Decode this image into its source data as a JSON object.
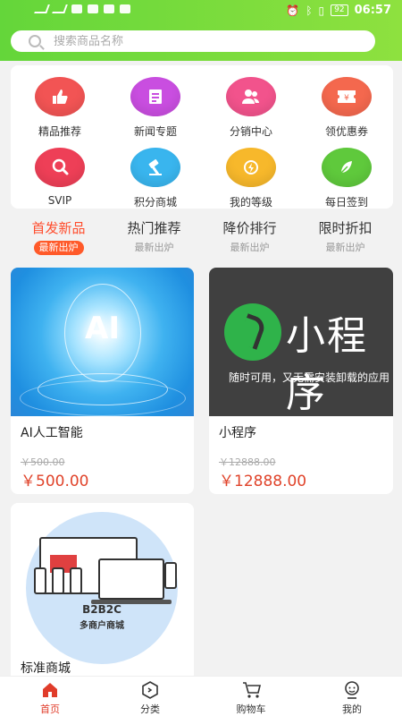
{
  "status_bar": {
    "time": "06:57",
    "battery": "92"
  },
  "search": {
    "placeholder": "搜索商品名称"
  },
  "menu": [
    {
      "label": "精品推荐",
      "icon": "thumbs-up-icon",
      "color": "#f25454"
    },
    {
      "label": "新闻专题",
      "icon": "news-icon",
      "color": "#c94ee0"
    },
    {
      "label": "分销中心",
      "icon": "users-icon",
      "color": "#f2538c"
    },
    {
      "label": "领优惠券",
      "icon": "coupon-icon",
      "color": "#f4684e"
    },
    {
      "label": "SVIP",
      "icon": "vip-icon",
      "color": "#ee3f57"
    },
    {
      "label": "积分商城",
      "icon": "hammer-icon",
      "color": "#39b5ee"
    },
    {
      "label": "我的等级",
      "icon": "level-icon",
      "color": "#f7b82b"
    },
    {
      "label": "每日签到",
      "icon": "sign-in-icon",
      "color": "#5fc93c"
    }
  ],
  "tabs": [
    {
      "title": "首发新品",
      "sub": "最新出炉"
    },
    {
      "title": "热门推荐",
      "sub": "最新出炉"
    },
    {
      "title": "降价排行",
      "sub": "最新出炉"
    },
    {
      "title": "限时折扣",
      "sub": "最新出炉"
    }
  ],
  "products": [
    {
      "name": "AI人工智能",
      "old_price": "￥500.00",
      "price": "￥500.00",
      "image_text": "AI"
    },
    {
      "name": "小程序",
      "old_price": "￥12888.00",
      "price": "￥12888.00",
      "image_title": "小程序",
      "image_sub": "随时可用，又无需安装卸载的应用"
    },
    {
      "name": "标准商城",
      "image_title": "B2B2C",
      "image_sub": "多商户商城"
    }
  ],
  "tabbar": [
    {
      "label": "首页",
      "icon": "home-icon"
    },
    {
      "label": "分类",
      "icon": "category-icon"
    },
    {
      "label": "购物车",
      "icon": "cart-icon"
    },
    {
      "label": "我的",
      "icon": "profile-icon"
    }
  ],
  "colors": {
    "header_green": "#7bdc3c",
    "accent_red": "#e0432a",
    "active_tab": "#ff4d2d"
  }
}
